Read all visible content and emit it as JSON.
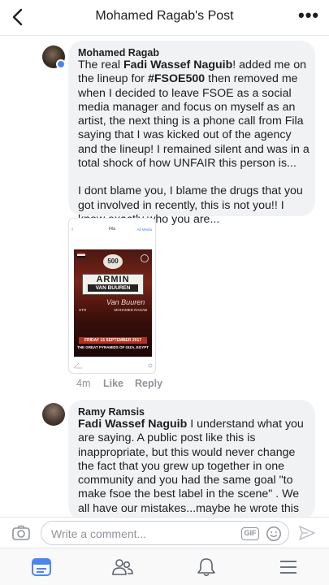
{
  "header": {
    "title": "Mohamed Ragab's Post"
  },
  "comments": [
    {
      "author": "Mohamed Ragab",
      "p1_a": "The real ",
      "p1_b": "Fadi Wassef Naguib",
      "p1_c": "! added me on the lineup for ",
      "p1_d": "#FSOE500",
      "p1_e": " then removed me when I decided to leave FSOE as a social media manager and focus on myself as an artist, the next thing is a phone call from Fila saying that I was kicked out of the agency and the lineup! I remained silent and was in a total shock of how UNFAIR this person is...",
      "p2": "I dont blame you, I blame the drugs that you got involved in recently, this is not you!! I know exactly who you are...",
      "time": "4m",
      "like": "Like",
      "reply": "Reply"
    },
    {
      "author": "Ramy Ramsis",
      "mention": "Fadi Wassef Naguib",
      "text": " I understand what you are saying. A public post like this is inappropriate, but this would never change the fact that you grew up together in one community and you had the same goal \"to make fsoe the best label in the scene\" . We all have our mistakes...maybe he wrote this when he was not in the mood. From a Fan"
    }
  ],
  "attachment": {
    "nav_title": "Fila",
    "nav_link": "All Media",
    "badge": "500",
    "headline_1": "ARMIN",
    "headline_2": "VAN BUUREN",
    "signature": "Van Buuren",
    "left_note": "STЯ",
    "right_note": "MOHAMED RAGAB",
    "date_line": "FRIDAY 15 SEPTEMBER 2017",
    "venue_line": "THE GREAT PYRAMIDS OF GIZA, EGYPT"
  },
  "composer": {
    "placeholder": "Write a comment...",
    "gif_label": "GIF"
  },
  "colors": {
    "accent": "#4b86f0",
    "bubble": "#f1f2f4",
    "meta": "#90949c"
  }
}
